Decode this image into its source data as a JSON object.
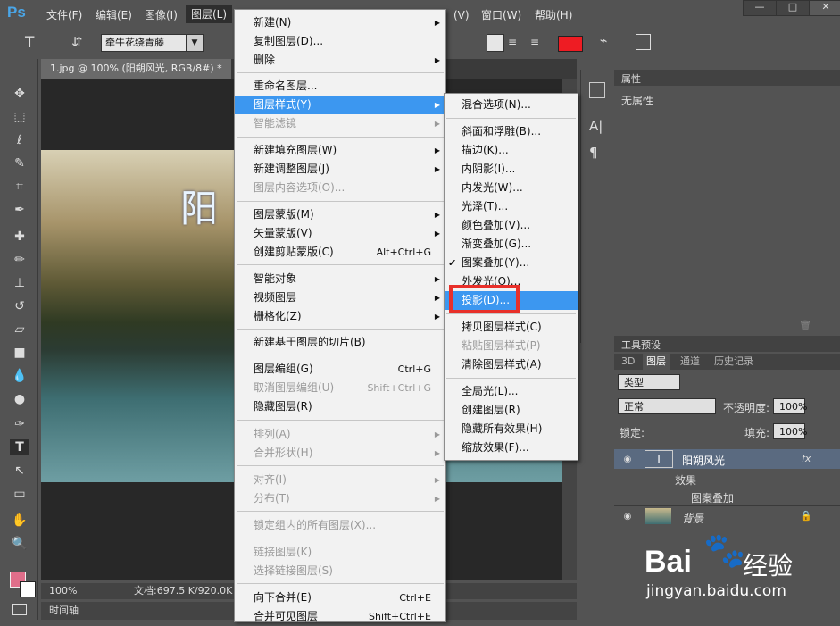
{
  "menubar": {
    "app": "Ps",
    "items": [
      "文件(F)",
      "编辑(E)",
      "图像(I)",
      "图层(L)"
    ],
    "right_items": [
      "(V)",
      "窗口(W)",
      "帮助(H)"
    ],
    "window_buttons": [
      "—",
      "□",
      "✕"
    ]
  },
  "options": {
    "font_name": "牵牛花绕青藤",
    "font_color": "#ee1c23"
  },
  "document": {
    "tab_title": "1.jpg @ 100% (阳朔风光, RGB/8#) *",
    "zoom": "100%",
    "file_info": "文档:697.5 K/920.0K",
    "timeline_label": "时间轴",
    "overlay_text": "阳"
  },
  "layer_menu": {
    "items": [
      {
        "label": "新建(N)",
        "arrow": true
      },
      {
        "label": "复制图层(D)...",
        "arrow": false
      },
      {
        "label": "删除",
        "arrow": true
      },
      {
        "label": "重命名图层...",
        "arrow": false
      },
      {
        "label": "图层样式(Y)",
        "arrow": true,
        "highlighted": true
      },
      {
        "label": "智能滤镜",
        "arrow": true,
        "disabled": true
      },
      {
        "label": "新建填充图层(W)",
        "arrow": true
      },
      {
        "label": "新建调整图层(J)",
        "arrow": true
      },
      {
        "label": "图层内容选项(O)...",
        "arrow": false,
        "disabled": true
      },
      {
        "label": "图层蒙版(M)",
        "arrow": true
      },
      {
        "label": "矢量蒙版(V)",
        "arrow": true
      },
      {
        "label": "创建剪贴蒙版(C)",
        "shortcut": "Alt+Ctrl+G"
      },
      {
        "label": "智能对象",
        "arrow": true
      },
      {
        "label": "视频图层",
        "arrow": true
      },
      {
        "label": "栅格化(Z)",
        "arrow": true
      },
      {
        "label": "新建基于图层的切片(B)",
        "arrow": false
      },
      {
        "label": "图层编组(G)",
        "shortcut": "Ctrl+G"
      },
      {
        "label": "取消图层编组(U)",
        "shortcut": "Shift+Ctrl+G",
        "disabled": true
      },
      {
        "label": "隐藏图层(R)",
        "arrow": false
      },
      {
        "label": "排列(A)",
        "arrow": true,
        "disabled": true
      },
      {
        "label": "合并形状(H)",
        "arrow": true,
        "disabled": true
      },
      {
        "label": "对齐(I)",
        "arrow": true,
        "disabled": true
      },
      {
        "label": "分布(T)",
        "arrow": true,
        "disabled": true
      },
      {
        "label": "锁定组内的所有图层(X)...",
        "disabled": true
      },
      {
        "label": "链接图层(K)",
        "disabled": true
      },
      {
        "label": "选择链接图层(S)",
        "disabled": true
      },
      {
        "label": "向下合并(E)",
        "shortcut": "Ctrl+E"
      },
      {
        "label": "合并可见图层",
        "shortcut": "Shift+Ctrl+E"
      }
    ]
  },
  "style_menu": {
    "items": [
      {
        "label": "混合选项(N)..."
      },
      {
        "label": "斜面和浮雕(B)..."
      },
      {
        "label": "描边(K)..."
      },
      {
        "label": "内阴影(I)..."
      },
      {
        "label": "内发光(W)..."
      },
      {
        "label": "光泽(T)..."
      },
      {
        "label": "颜色叠加(V)..."
      },
      {
        "label": "渐变叠加(G)..."
      },
      {
        "label": "图案叠加(Y)...",
        "checked": true
      },
      {
        "label": "外发光(O)..."
      },
      {
        "label": "投影(D)...",
        "highlighted": true
      },
      {
        "label": "拷贝图层样式(C)"
      },
      {
        "label": "粘贴图层样式(P)",
        "disabled": true
      },
      {
        "label": "清除图层样式(A)"
      },
      {
        "label": "全局光(L)..."
      },
      {
        "label": "创建图层(R)"
      },
      {
        "label": "隐藏所有效果(H)"
      },
      {
        "label": "缩放效果(F)..."
      }
    ]
  },
  "properties": {
    "title": "属性",
    "empty": "无属性"
  },
  "tool_presets": {
    "title": "工具预设"
  },
  "layers_panel": {
    "tabs": [
      "3D",
      "图层",
      "通道",
      "历史记录"
    ],
    "filter": "类型",
    "blend_mode": "正常",
    "opacity_label": "不透明度:",
    "opacity": "100%",
    "lock_label": "锁定:",
    "fill_label": "填充:",
    "fill": "100%",
    "layers": [
      {
        "name": "阳朔风光",
        "type": "text",
        "fx": "fx"
      },
      {
        "name": "效果",
        "indent": 1
      },
      {
        "name": "图案叠加",
        "indent": 2
      },
      {
        "name": "背景",
        "type": "image"
      }
    ]
  },
  "watermark": {
    "brand": "Bai",
    "brand2": "经验",
    "url": "jingyan.baidu.com"
  }
}
